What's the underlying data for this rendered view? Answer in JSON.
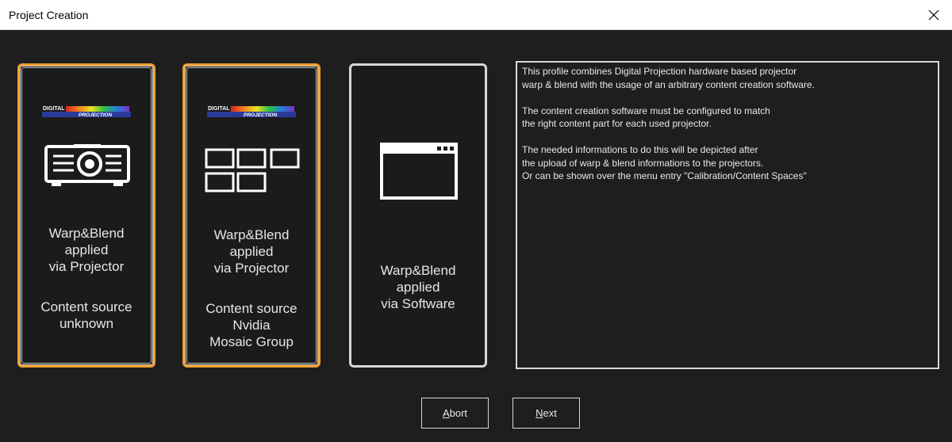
{
  "window": {
    "title": "Project Creation"
  },
  "cards": [
    {
      "logo_text": [
        "DIGITAL",
        "PROJECTION"
      ],
      "icon": "projector-icon",
      "lines_main": [
        "Warp&Blend",
        "applied",
        "via Projector"
      ],
      "lines_sub": [
        "Content source",
        "unknown"
      ],
      "selected": true
    },
    {
      "logo_text": [
        "DIGITAL",
        "PROJECTION"
      ],
      "icon": "display-grid-icon",
      "lines_main": [
        "Warp&Blend",
        "applied",
        "via Projector"
      ],
      "lines_sub": [
        "Content source",
        "Nvidia",
        "Mosaic Group"
      ],
      "selected": true
    },
    {
      "icon": "software-window-icon",
      "lines_main": [
        "Warp&Blend",
        "applied",
        "via Software"
      ],
      "selected": false
    }
  ],
  "description": {
    "text": "This profile combines Digital Projection hardware based projector\nwarp & blend with the usage of an arbitrary content creation software.\n\nThe content creation software must be configured to match\nthe right content part for each used projector.\n\nThe needed informations to do this will be depicted after\nthe upload of warp & blend informations to the projectors.\nOr can be shown over the menu entry \"Calibration/Content Spaces\""
  },
  "buttons": {
    "abort_mnemonic": "A",
    "abort_rest": "bort",
    "next_mnemonic": "N",
    "next_rest": "ext"
  },
  "colors": {
    "background": "#1e1e1e",
    "selected_border": "#f0a030",
    "border": "#d8d8d8",
    "text": "#e8e8e8"
  }
}
